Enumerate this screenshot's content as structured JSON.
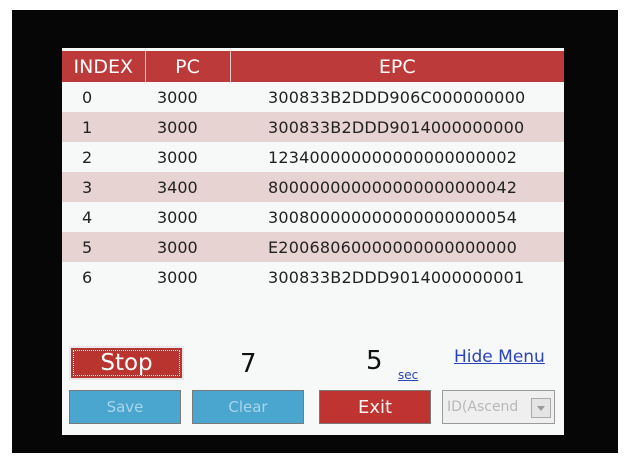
{
  "table": {
    "headers": {
      "index": "INDEX",
      "pc": "PC",
      "epc": "EPC"
    },
    "rows": [
      {
        "index": "0",
        "pc": "3000",
        "epc": "300833B2DDD906C000000000"
      },
      {
        "index": "1",
        "pc": "3000",
        "epc": "300833B2DDD9014000000000"
      },
      {
        "index": "2",
        "pc": "3000",
        "epc": "123400000000000000000002"
      },
      {
        "index": "3",
        "pc": "3400",
        "epc": "800000000000000000000042"
      },
      {
        "index": "4",
        "pc": "3000",
        "epc": "300800000000000000000054"
      },
      {
        "index": "5",
        "pc": "3000",
        "epc": "E20068060000000000000000"
      },
      {
        "index": "6",
        "pc": "3000",
        "epc": "300833B2DDD9014000000001"
      }
    ]
  },
  "controls": {
    "stop_label": "Stop",
    "tag_count": "7",
    "time_value": "5",
    "time_unit": "sec",
    "hide_menu_label": "Hide Menu",
    "save_label": "Save",
    "clear_label": "Clear",
    "exit_label": "Exit",
    "sort_selected": "ID(Ascend"
  },
  "colors": {
    "header": "#bd3a3a",
    "row_alt": "#e7d3d1",
    "stop_button": "#b9332f",
    "exit_button": "#bf3431",
    "disabled_button": "#4aa6cf",
    "link": "#2a43b8"
  },
  "icons": {
    "sort_dropdown": "chevron-down-icon"
  }
}
